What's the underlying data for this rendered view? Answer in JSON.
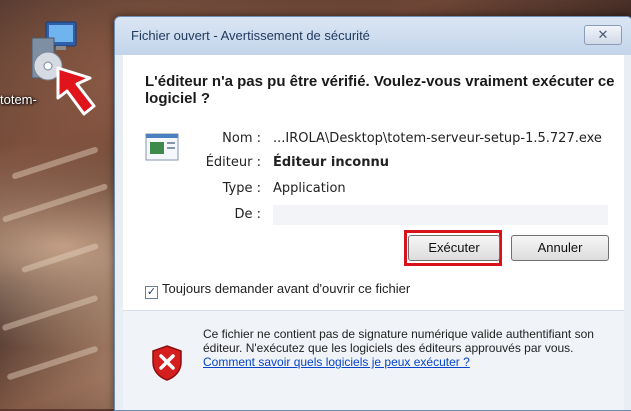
{
  "desktop": {
    "icon_label": "totem-"
  },
  "dialog": {
    "title": "Fichier ouvert - Avertissement de sécurité",
    "close_glyph": "✕",
    "question": "L'éditeur n'a pas pu être vérifié. Voulez-vous vraiment exécuter ce logiciel ?",
    "fields": {
      "nom_label": "Nom :",
      "nom_value": "...IROLA\\Desktop\\totem-serveur-setup-1.5.727.exe",
      "editeur_label": "Éditeur :",
      "editeur_value": "Éditeur inconnu",
      "type_label": "Type :",
      "type_value": "Application",
      "de_label": "De :",
      "de_value": ""
    },
    "buttons": {
      "run": "Exécuter",
      "cancel": "Annuler"
    },
    "checkbox": {
      "label": "Toujours demander avant d'ouvrir ce fichier",
      "checked": true,
      "check_glyph": "✓"
    },
    "warning": {
      "text": "Ce fichier ne contient pas de signature numérique valide authentifiant son éditeur. N'exécutez que les logiciels des éditeurs approuvés par vous. ",
      "link": "Comment savoir quels logiciels je peux exécuter ?"
    }
  },
  "colors": {
    "highlight": "#d8121b",
    "link": "#0645c8"
  }
}
